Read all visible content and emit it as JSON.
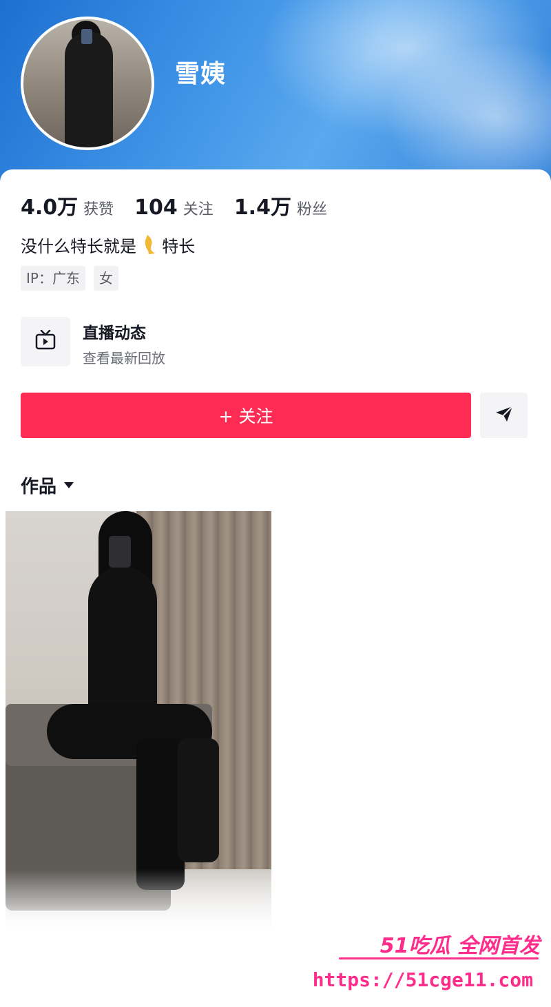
{
  "profile": {
    "name": "雪姨",
    "stats": [
      {
        "value": "4.0万",
        "label": "获赞"
      },
      {
        "value": "104",
        "label": "关注"
      },
      {
        "value": "1.4万",
        "label": "粉丝"
      }
    ],
    "bio_prefix": "没什么特长就是",
    "bio_emoji": "leg-emoji",
    "bio_suffix": "特长",
    "tags": [
      "IP：广东",
      "女"
    ]
  },
  "live": {
    "icon": "tv-icon",
    "title": "直播动态",
    "subtitle": "查看最新回放"
  },
  "actions": {
    "follow_label": "+ 关注",
    "share_icon": "send-icon"
  },
  "works": {
    "tab_label": "作品",
    "dropdown_icon": "caret-down-icon"
  },
  "watermark": {
    "top": "51吃瓜 全网首发",
    "url": "https://51cge11.com"
  },
  "colors": {
    "accent": "#fe2c55",
    "header_blue": "#3d92e6",
    "watermark_pink": "#fe2c8a"
  }
}
